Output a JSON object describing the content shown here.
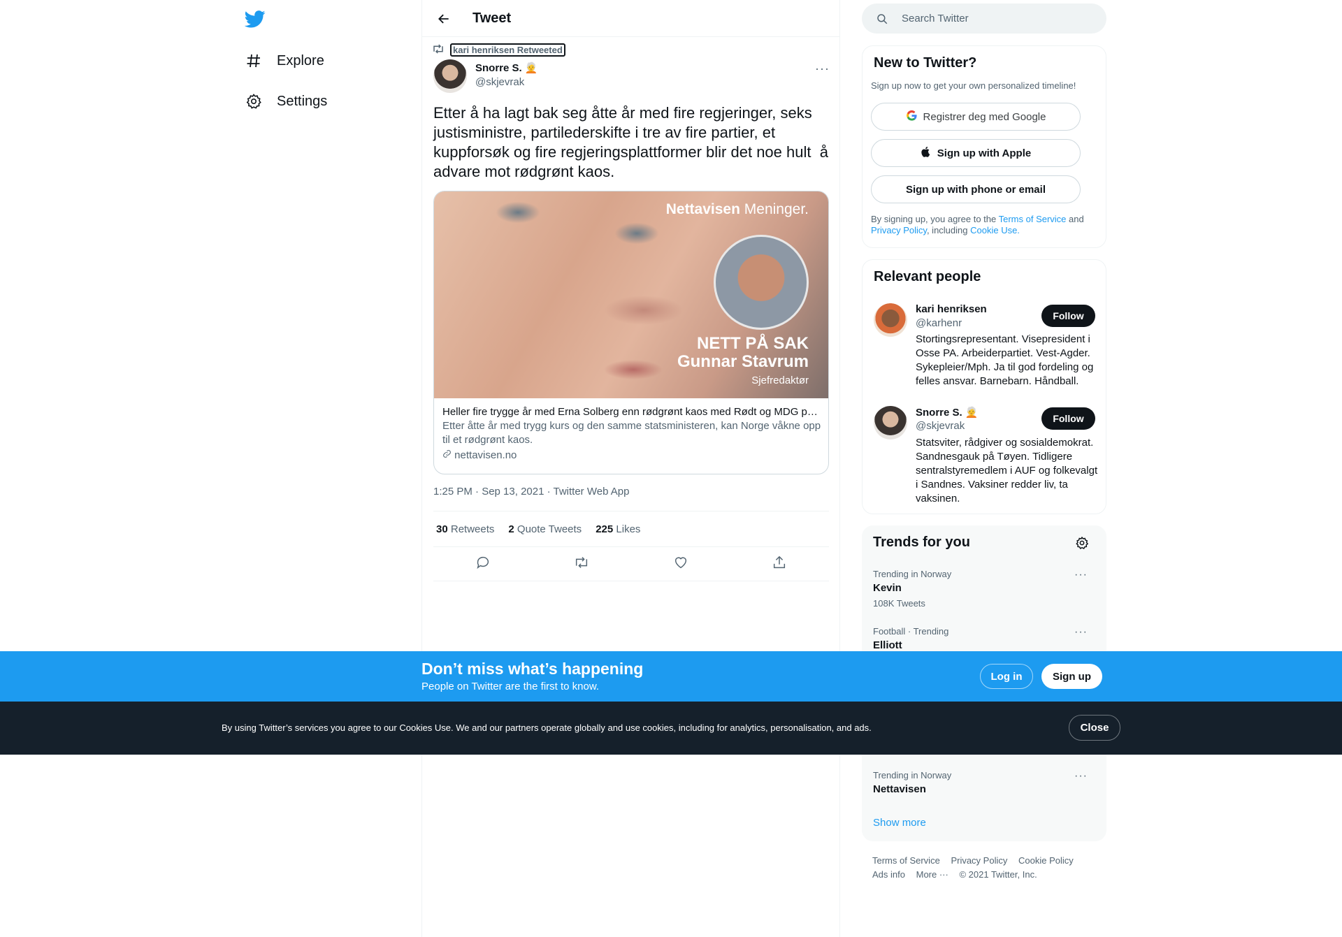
{
  "nav": {
    "explore": "Explore",
    "settings": "Settings"
  },
  "header": {
    "title": "Tweet"
  },
  "tweet": {
    "retweeted_by": "kari henriksen Retweeted",
    "author_name": "Snorre S. 🧑‍🦳",
    "author_handle": "@skjevrak",
    "more": "···",
    "text": "Etter å ha lagt bak seg åtte år med fire regjeringer, seks justisministre, partilederskifte i tre av fire partier, et kuppforsøk og fire regjeringsplattformer blir det noe hult  å advare mot rødgrønt kaos.",
    "card": {
      "image_brand": "Nettavisen",
      "image_brand_suffix": " Meninger.",
      "image_headline_1": "NETT PÅ SAK",
      "image_headline_2": "Gunnar Stavrum",
      "image_subline": "Sjefredaktør",
      "title": "Heller fire trygge år med Erna Solberg enn rødgrønt kaos med Rødt og MDG på laget",
      "description": "Etter åtte år med trygg kurs og den samme statsministeren, kan Norge våkne opp til et rødgrønt kaos.",
      "domain": "nettavisen.no"
    },
    "meta": "1:25 PM · Sep 13, 2021 · Twitter Web App",
    "stats": {
      "retweets_count": "30",
      "retweets_label": "Retweets",
      "quotes_count": "2",
      "quotes_label": "Quote Tweets",
      "likes_count": "225",
      "likes_label": "Likes"
    }
  },
  "search": {
    "placeholder": "Search Twitter"
  },
  "new_to_twitter": {
    "title": "New to Twitter?",
    "subtitle": "Sign up now to get your own personalized timeline!",
    "google": "Registrer deg med Google",
    "apple": "Sign up with Apple",
    "phone": "Sign up with phone or email",
    "legal_1": "By signing up, you agree to the ",
    "terms": "Terms of Service",
    "legal_2": " and ",
    "privacy": "Privacy Policy",
    "legal_3": ", including ",
    "cookie": "Cookie Use."
  },
  "relevant": {
    "title": "Relevant people",
    "follow_label": "Follow",
    "people": [
      {
        "name": "kari henriksen",
        "handle": "@karhenr",
        "bio": "Stortingsrepresentant. Visepresident i Osse PA. Arbeiderpartiet. Vest-Agder. Sykepleier/Mph. Ja til god fordeling og felles ansvar. Barnebarn. Håndball."
      },
      {
        "name": "Snorre S. 🧑‍🦳",
        "handle": "@skjevrak",
        "bio": "Statsviter, rådgiver og sosialdemokrat. Sandnesgauk på Tøyen. Tidligere sentralstyremedlem i AUF og folkevalgt i Sandnes. Vaksiner redder liv, ta vaksinen."
      }
    ]
  },
  "trends": {
    "title": "Trends for you",
    "items": [
      {
        "meta": "Trending in Norway",
        "name": "Kevin",
        "count": "108K Tweets"
      },
      {
        "meta": "Football · Trending",
        "name": "Elliott",
        "count": ""
      },
      {
        "meta": "Trending in Norway",
        "name": "Nettavisen",
        "count": ""
      }
    ],
    "show_more": "Show more"
  },
  "footer": {
    "terms": "Terms of Service",
    "privacy": "Privacy Policy",
    "cookie": "Cookie Policy",
    "ads": "Ads info",
    "more": "More ···",
    "copyright": "© 2021 Twitter, Inc."
  },
  "banner": {
    "title": "Don’t miss what’s happening",
    "subtitle": "People on Twitter are the first to know.",
    "login": "Log in",
    "signup": "Sign up"
  },
  "cookie_bar": {
    "text": "By using Twitter’s services you agree to our Cookies Use. We and our partners operate globally and use cookies, including for analytics, personalisation, and ads.",
    "close": "Close"
  },
  "colors": {
    "accent": "#1d9bf0",
    "text": "#0f1419",
    "muted": "#536471",
    "dark_bar": "#15202b"
  }
}
